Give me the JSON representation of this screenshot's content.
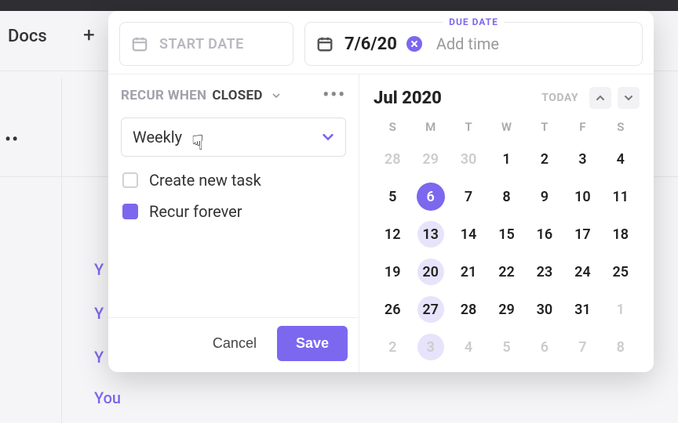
{
  "background": {
    "docs_label": "Docs",
    "items": [
      "Y",
      "Y",
      "Y",
      "You"
    ]
  },
  "dates": {
    "due_label": "DUE DATE",
    "start_placeholder": "START DATE",
    "due_value": "7/6/20",
    "add_time": "Add time"
  },
  "recur": {
    "label_prefix": "RECUR WHEN",
    "state": "CLOSED",
    "frequency": "Weekly",
    "create_new_task_label": "Create new task",
    "create_new_task_checked": false,
    "recur_forever_label": "Recur forever",
    "recur_forever_checked": true
  },
  "calendar": {
    "month_title": "Jul 2020",
    "today_label": "TODAY",
    "weekdays": [
      "S",
      "M",
      "T",
      "W",
      "T",
      "F",
      "S"
    ],
    "rows": [
      [
        {
          "n": "28",
          "muted": true
        },
        {
          "n": "29",
          "muted": true
        },
        {
          "n": "30",
          "muted": true
        },
        {
          "n": "1"
        },
        {
          "n": "2"
        },
        {
          "n": "3"
        },
        {
          "n": "4"
        }
      ],
      [
        {
          "n": "5"
        },
        {
          "n": "6",
          "today": true
        },
        {
          "n": "7"
        },
        {
          "n": "8"
        },
        {
          "n": "9"
        },
        {
          "n": "10"
        },
        {
          "n": "11"
        }
      ],
      [
        {
          "n": "12"
        },
        {
          "n": "13",
          "sel": true
        },
        {
          "n": "14"
        },
        {
          "n": "15"
        },
        {
          "n": "16"
        },
        {
          "n": "17"
        },
        {
          "n": "18"
        }
      ],
      [
        {
          "n": "19"
        },
        {
          "n": "20",
          "sel": true
        },
        {
          "n": "21"
        },
        {
          "n": "22"
        },
        {
          "n": "23"
        },
        {
          "n": "24"
        },
        {
          "n": "25"
        }
      ],
      [
        {
          "n": "26"
        },
        {
          "n": "27",
          "sel": true
        },
        {
          "n": "28"
        },
        {
          "n": "29"
        },
        {
          "n": "30"
        },
        {
          "n": "31"
        },
        {
          "n": "1",
          "muted": true
        }
      ],
      [
        {
          "n": "2",
          "muted": true
        },
        {
          "n": "3",
          "sel": true,
          "muted": true
        },
        {
          "n": "4",
          "muted": true
        },
        {
          "n": "5",
          "muted": true
        },
        {
          "n": "6",
          "muted": true
        },
        {
          "n": "7",
          "muted": true
        },
        {
          "n": "8",
          "muted": true
        }
      ]
    ]
  },
  "footer": {
    "cancel": "Cancel",
    "save": "Save"
  },
  "colors": {
    "accent": "#7b68ee"
  }
}
